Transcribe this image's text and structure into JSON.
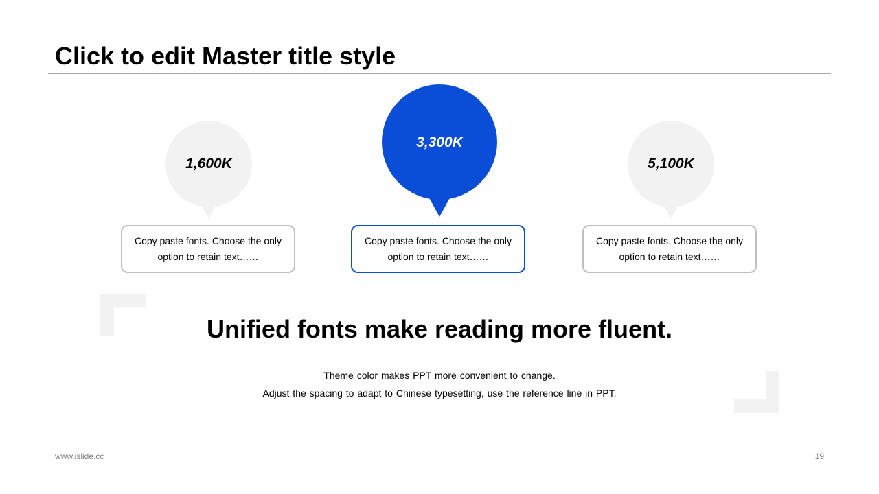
{
  "slide": {
    "title": "Click to edit Master title style",
    "bubbles": [
      {
        "value": "1,600K",
        "color": "#f2f2f2"
      },
      {
        "value": "3,300K",
        "color": "#0a4ed8"
      },
      {
        "value": "5,100K",
        "color": "#f2f2f2"
      }
    ],
    "cards": [
      {
        "text": "Copy paste fonts. Choose the only option to retain text……"
      },
      {
        "text": "Copy paste fonts. Choose the only option to retain text……"
      },
      {
        "text": "Copy paste fonts. Choose the only option to retain text……"
      }
    ],
    "headline": "Unified fonts make reading more fluent.",
    "subtext": [
      "Theme color makes PPT more convenient to change.",
      "Adjust the spacing to adapt to Chinese typesetting, use the reference line in PPT."
    ],
    "footer": {
      "url": "www.islide.cc",
      "page_number": "19"
    },
    "colors": {
      "accent": "#0a4ed8",
      "neutral": "#f2f2f2",
      "border": "#bfbfbf"
    }
  }
}
